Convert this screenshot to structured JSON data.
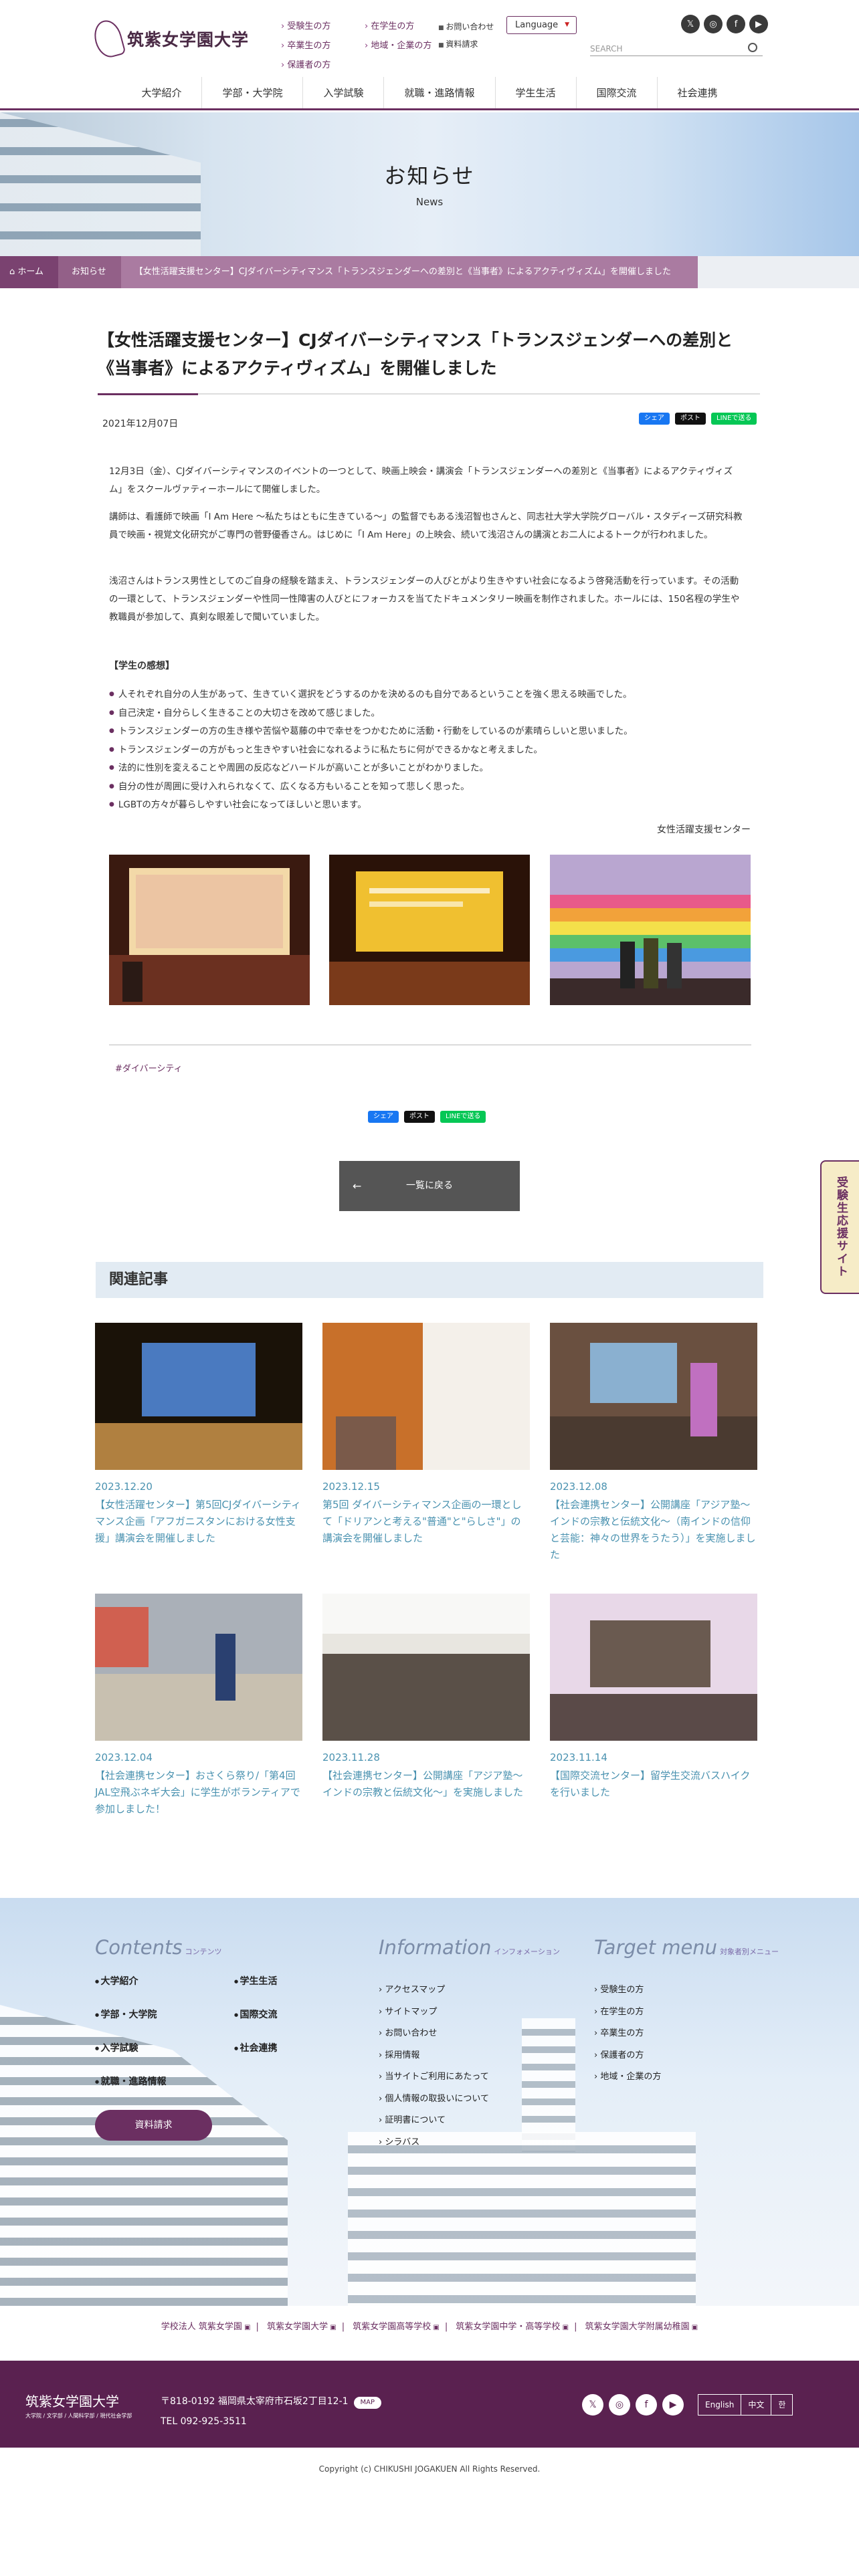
{
  "header": {
    "logo_text": "筑紫女学園大学",
    "top_nav": [
      "受験生の方",
      "在学生の方",
      "卒業生の方",
      "地域・企業の方",
      "保護者の方"
    ],
    "util_nav": [
      "お問い合わせ",
      "資料請求"
    ],
    "language_label": "Language",
    "sns": [
      "x-icon",
      "instagram-icon",
      "facebook-icon",
      "youtube-icon"
    ],
    "search_placeholder": "SEARCH",
    "global_nav": [
      "大学紹介",
      "学部・大学院",
      "入学試験",
      "就職・進路情報",
      "学生生活",
      "国際交流",
      "社会連携"
    ]
  },
  "hero": {
    "title": "お知らせ",
    "subtitle": "News"
  },
  "breadcrumb": [
    "ホーム",
    "お知らせ",
    "【女性活躍支援センター】CJダイバーシティマンス「トランスジェンダーへの差別と《当事者》によるアクティヴィズム」を開催しました"
  ],
  "article": {
    "title": "【女性活躍支援センター】CJダイバーシティマンス「トランスジェンダーへの差別と《当事者》によるアクティヴィズム」を開催しました",
    "date": "2021年12月07日",
    "share": [
      "シェア",
      "ポスト",
      "LINEで送る"
    ],
    "p1": "12月3日（金）、CJダイバーシティマンスのイベントの一つとして、映画上映会・講演会「トランスジェンダーへの差別と《当事者》によるアクティヴィズム」をスクールヴァティーホールにて開催しました。",
    "p2": "講師は、看護師で映画「I Am Here 〜私たちはともに生きている〜」の監督でもある浅沼智也さんと、同志社大学大学院グローバル・スタディーズ研究科教員で映画・視覚文化研究がご専門の菅野優香さん。はじめに「I Am Here」の上映会、続いて浅沼さんの講演とお二人によるトークが行われました。",
    "p3": "浅沼さんはトランス男性としてのご自身の経験を踏まえ、トランスジェンダーの人びとがより生きやすい社会になるよう啓発活動を行っています。その活動の一環として、トランスジェンダーや性同一性障害の人びとにフォーカスを当てたドキュメンタリー映画を制作されました。ホールには、150名程の学生や教職員が参加して、真剣な眼差しで聞いていました。",
    "impressions_heading": "【学生の感想】",
    "impressions": [
      "人それぞれ自分の人生があって、生きていく選択をどうするのかを決めるのも自分であるということを強く思える映画でした。",
      "自己決定・自分らしく生きることの大切さを改めて感じました。",
      "トランスジェンダーの方の生き様や苦悩や葛藤の中で幸せをつかむために活動・行動をしているのが素晴らしいと思いました。",
      "トランスジェンダーの方がもっと生きやすい社会になれるように私たちに何ができるかなと考えました。",
      "法的に性別を変えることや周囲の反応などハードルが高いことが多いことがわかりました。",
      "自分の性が周囲に受け入れられなくて、広くなる方もいることを知って悲しく思った。",
      "LGBTの方々が暮らしやすい社会になってほしいと思います。"
    ],
    "signature": "女性活躍支援センター",
    "tag": "#ダイバーシティ",
    "back_label": "一覧に戻る"
  },
  "side_tab": "受験生応援サイト",
  "related": {
    "heading": "関連記事",
    "items": [
      {
        "date": "2023.12.20",
        "title": "【女性活躍センター】第5回CJダイバーシティマンス企画「アフガニスタンにおける女性支援」講演会を開催しました"
      },
      {
        "date": "2023.12.15",
        "title": "第5回 ダイバーシティマンス企画の一環として「ドリアンと考える\"普通\"と\"らしさ\"」の講演会を開催しました"
      },
      {
        "date": "2023.12.08",
        "title": "【社会連携センター】公開講座「アジア塾〜インドの宗教と伝統文化〜（南インドの信仰と芸能：神々の世界をうたう）」を実施しました"
      },
      {
        "date": "2023.12.04",
        "title": "【社会連携センター】おさくら祭り/「第4回JAL空飛ぶネギ大会」に学生がボランティアで参加しました！"
      },
      {
        "date": "2023.11.28",
        "title": "【社会連携センター】公開講座「アジア塾〜インドの宗教と伝統文化〜」を実施しました"
      },
      {
        "date": "2023.11.14",
        "title": "【国際交流センター】留学生交流バスハイクを行いました"
      }
    ]
  },
  "footer": {
    "contents_title": "Contents",
    "contents_sub": "コンテンツ",
    "contents_col1": [
      "大学紹介",
      "学部・大学院",
      "入学試験",
      "就職・進路情報"
    ],
    "contents_col2": [
      "学生生活",
      "国際交流",
      "社会連携"
    ],
    "shiryo_label": "資料請求",
    "info_title": "Information",
    "info_sub": "インフォメーション",
    "info_links": [
      "アクセスマップ",
      "サイトマップ",
      "お問い合わせ",
      "採用情報",
      "当サイトご利用にあたって",
      "個人情報の取扱いについて",
      "証明書について",
      "シラバス"
    ],
    "target_title": "Target menu",
    "target_sub": "対象者別メニュー",
    "target_links": [
      "受験生の方",
      "在学生の方",
      "卒業生の方",
      "保護者の方",
      "地域・企業の方"
    ],
    "related_sites": [
      "学校法人 筑紫女学園",
      "筑紫女学園大学",
      "筑紫女学園高等学校",
      "筑紫女学園中学・高等学校",
      "筑紫女学園大学附属幼稚園"
    ],
    "bar_logo": "筑紫女学園大学",
    "bar_logo_sub": "大学院 / 文学部 / 人間科学部 / 現代社会学部",
    "address": "〒818-0192 福岡県太宰府市石坂2丁目12-1",
    "map_label": "MAP",
    "tel": "TEL 092-925-3511",
    "langs": [
      "English",
      "中文",
      "한"
    ],
    "copyright": "Copyright (c) CHIKUSHI JOGAKUEN All Rights Reserved."
  }
}
